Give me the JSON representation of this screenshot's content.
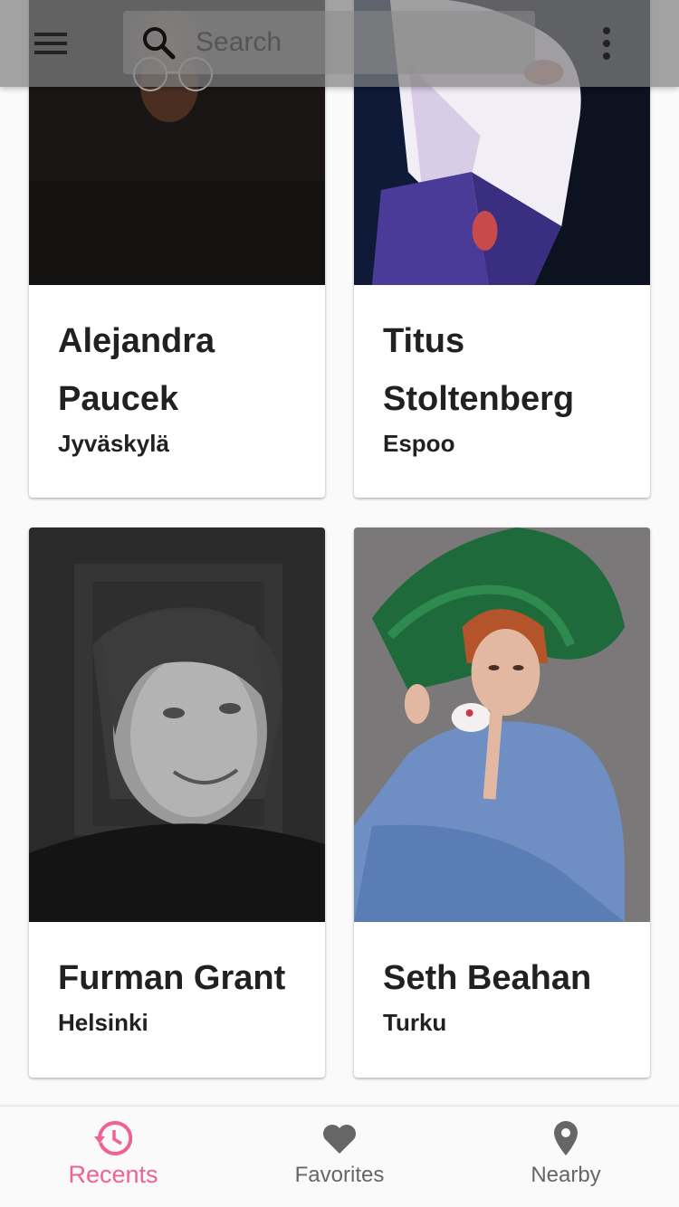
{
  "colors": {
    "accent": "#f06292",
    "inactive": "#666666",
    "text": "#212121",
    "card_bg": "#ffffff",
    "page_bg": "#fafafa"
  },
  "appbar": {
    "menu_icon": "hamburger-menu-icon",
    "search_icon": "search-icon",
    "search_placeholder": "Search",
    "search_value": "",
    "more_icon": "more-vertical-icon"
  },
  "people": [
    {
      "name": "Alejandra Paucek",
      "city": "Jyväskylä"
    },
    {
      "name": "Titus Stoltenberg",
      "city": "Espoo"
    },
    {
      "name": "Furman Grant",
      "city": "Helsinki"
    },
    {
      "name": "Seth Beahan",
      "city": "Turku"
    }
  ],
  "bottom_nav": [
    {
      "label": "Recents",
      "icon": "history-icon",
      "active": true
    },
    {
      "label": "Favorites",
      "icon": "heart-icon",
      "active": false
    },
    {
      "label": "Nearby",
      "icon": "location-pin-icon",
      "active": false
    }
  ]
}
